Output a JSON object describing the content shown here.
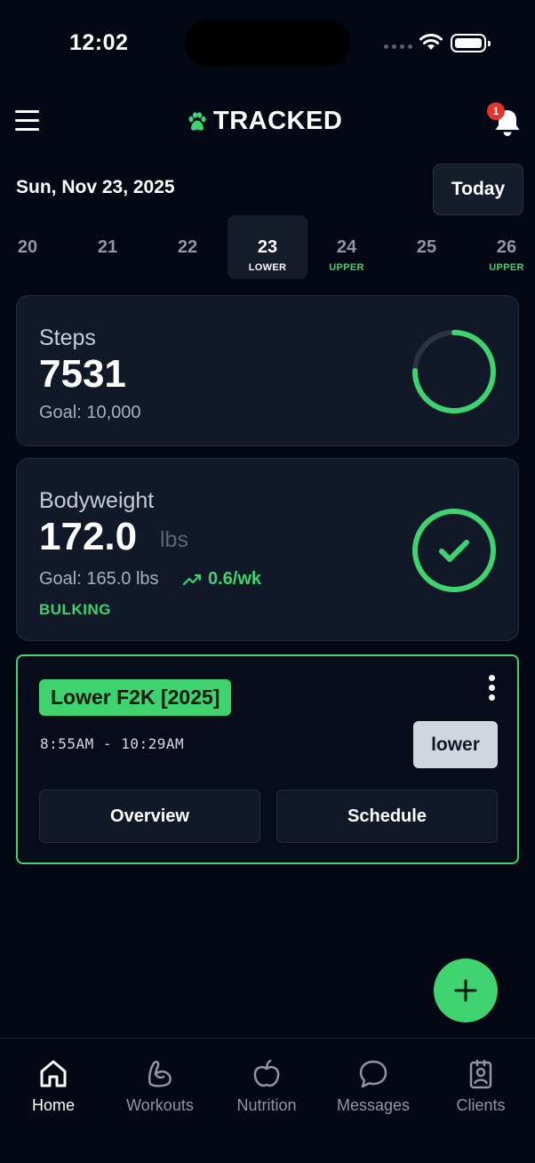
{
  "status_bar": {
    "time": "12:02"
  },
  "header": {
    "brand": "TRACKED",
    "notification_count": "1"
  },
  "date_row": {
    "date": "Sun, Nov 23, 2025",
    "today_label": "Today"
  },
  "days": [
    {
      "num": "20",
      "tag": ""
    },
    {
      "num": "21",
      "tag": ""
    },
    {
      "num": "22",
      "tag": ""
    },
    {
      "num": "23",
      "tag": "LOWER"
    },
    {
      "num": "24",
      "tag": "UPPER"
    },
    {
      "num": "25",
      "tag": ""
    },
    {
      "num": "26",
      "tag": "UPPER"
    }
  ],
  "steps": {
    "title": "Steps",
    "value": "7531",
    "goal": "Goal: 10,000",
    "progress": 0.7531
  },
  "bodyweight": {
    "title": "Bodyweight",
    "value": "172.0",
    "unit": "lbs",
    "goal": "Goal: 165.0 lbs",
    "rate": "0.6/wk",
    "phase": "BULKING"
  },
  "workout": {
    "name": "Lower F2K [2025]",
    "time": "8:55AM - 10:29AM",
    "type": "lower",
    "overview_label": "Overview",
    "schedule_label": "Schedule"
  },
  "nav": [
    {
      "label": "Home",
      "active": true
    },
    {
      "label": "Workouts",
      "active": false
    },
    {
      "label": "Nutrition",
      "active": false
    },
    {
      "label": "Messages",
      "active": false
    },
    {
      "label": "Clients",
      "active": false
    }
  ],
  "colors": {
    "accent": "#3fd36f",
    "background": "#030814",
    "card": "#111827",
    "badge": "#e5322d"
  }
}
